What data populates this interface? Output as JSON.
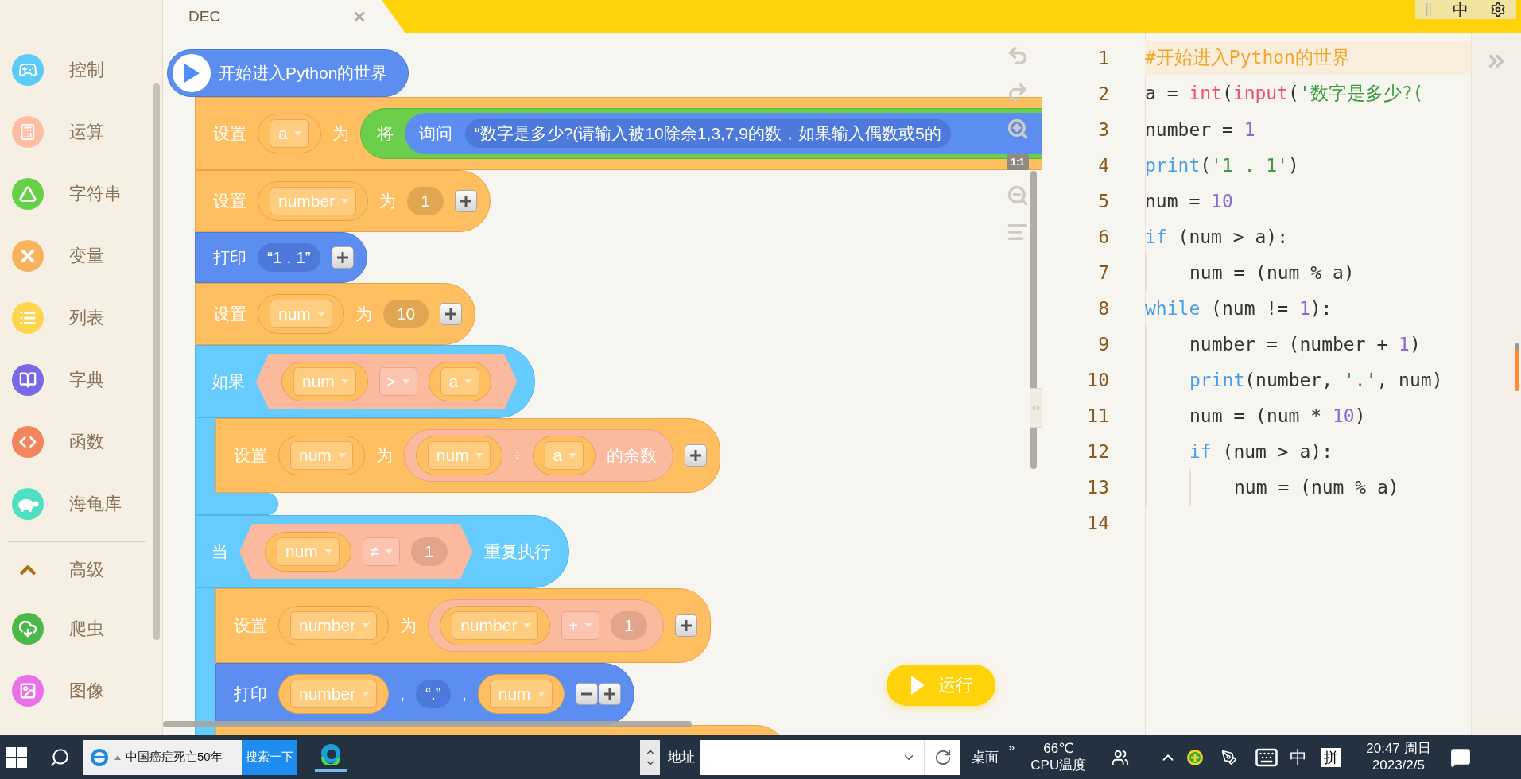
{
  "sidebar": {
    "categories": [
      {
        "label": "控制",
        "color": "#5ccbfa"
      },
      {
        "label": "运算",
        "color": "#ffbda3"
      },
      {
        "label": "字符串",
        "color": "#66d04a"
      },
      {
        "label": "变量",
        "color": "#f8b15c"
      },
      {
        "label": "列表",
        "color": "#ffd54f"
      },
      {
        "label": "字典",
        "color": "#7b68e6"
      },
      {
        "label": "函数",
        "color": "#f2855e"
      },
      {
        "label": "海龟库",
        "color": "#4ee0c2"
      }
    ],
    "advanced": {
      "label": "高级",
      "expanded": true
    },
    "extras": [
      {
        "label": "爬虫",
        "color": "#4cb84a"
      },
      {
        "label": "图像",
        "color": "#ea6fe9"
      }
    ]
  },
  "tab": {
    "title": "DEC"
  },
  "top_right": {
    "ime": "中"
  },
  "canvas_tools": {
    "zoom_reset": "1:1"
  },
  "blocks": [
    {
      "kind": "hat",
      "text": "开始进入Python的世界"
    },
    {
      "kind": "set",
      "parts": [
        {
          "kind": "label",
          "text": "设置"
        },
        {
          "kind": "var",
          "text": "a"
        },
        {
          "kind": "label",
          "text": "为"
        },
        {
          "kind": "convert",
          "label": "将",
          "ask": {
            "label": "询问",
            "value": "“数字是多少?(请输入被10除余1,3,7,9的数，如果输入偶数或5的"
          }
        }
      ]
    },
    {
      "kind": "set",
      "parts": [
        {
          "kind": "label",
          "text": "设置"
        },
        {
          "kind": "var",
          "text": "number"
        },
        {
          "kind": "label",
          "text": "为"
        },
        {
          "kind": "number",
          "text": "1"
        },
        {
          "kind": "plus"
        }
      ]
    },
    {
      "kind": "print",
      "parts": [
        {
          "kind": "label",
          "text": "打印"
        },
        {
          "kind": "string",
          "text": "“1 . 1”"
        },
        {
          "kind": "plus"
        }
      ]
    },
    {
      "kind": "set",
      "parts": [
        {
          "kind": "label",
          "text": "设置"
        },
        {
          "kind": "var",
          "text": "num"
        },
        {
          "kind": "label",
          "text": "为"
        },
        {
          "kind": "number",
          "text": "10"
        },
        {
          "kind": "plus"
        }
      ]
    },
    {
      "kind": "if",
      "parts": [
        {
          "kind": "label",
          "text": "如果"
        },
        {
          "kind": "cond",
          "parts": [
            {
              "kind": "var",
              "text": "num"
            },
            {
              "kind": "op",
              "text": ">"
            },
            {
              "kind": "var",
              "text": "a"
            }
          ]
        }
      ],
      "children": [
        {
          "kind": "set",
          "parts": [
            {
              "kind": "label",
              "text": "设置"
            },
            {
              "kind": "var",
              "text": "num"
            },
            {
              "kind": "label",
              "text": "为"
            },
            {
              "kind": "expr",
              "parts": [
                {
                  "kind": "var",
                  "text": "num"
                },
                {
                  "kind": "symbol",
                  "text": "÷"
                },
                {
                  "kind": "var",
                  "text": "a"
                },
                {
                  "kind": "label",
                  "text": "的余数"
                }
              ]
            },
            {
              "kind": "plus"
            }
          ]
        }
      ]
    },
    {
      "kind": "while",
      "parts": [
        {
          "kind": "label",
          "text": "当"
        },
        {
          "kind": "cond",
          "parts": [
            {
              "kind": "var",
              "text": "num"
            },
            {
              "kind": "op",
              "text": "≠"
            },
            {
              "kind": "number",
              "text": "1"
            }
          ]
        },
        {
          "kind": "label",
          "text": "重复执行"
        }
      ],
      "children": [
        {
          "kind": "set",
          "parts": [
            {
              "kind": "label",
              "text": "设置"
            },
            {
              "kind": "var",
              "text": "number"
            },
            {
              "kind": "label",
              "text": "为"
            },
            {
              "kind": "expr",
              "parts": [
                {
                  "kind": "var",
                  "text": "number"
                },
                {
                  "kind": "op",
                  "text": "+"
                },
                {
                  "kind": "number",
                  "text": "1"
                }
              ]
            },
            {
              "kind": "plus"
            }
          ]
        },
        {
          "kind": "print",
          "parts": [
            {
              "kind": "label",
              "text": "打印"
            },
            {
              "kind": "var",
              "text": "number"
            },
            {
              "kind": "label",
              "text": ","
            },
            {
              "kind": "string",
              "text": "“.”"
            },
            {
              "kind": "label",
              "text": ","
            },
            {
              "kind": "var",
              "text": "num"
            },
            {
              "kind": "minus"
            },
            {
              "kind": "plus"
            }
          ]
        },
        {
          "kind": "stub"
        }
      ]
    }
  ],
  "run_button": {
    "label": "运行"
  },
  "editor": {
    "lines": [
      {
        "number": "1",
        "highlighted": true,
        "tokens": [
          {
            "kind": "comment",
            "text": "#开始进入Python的世界"
          }
        ]
      },
      {
        "number": "2",
        "highlighted": false,
        "tokens": [
          {
            "kind": "plain",
            "text": "a = "
          },
          {
            "kind": "builtin",
            "text": "int"
          },
          {
            "kind": "plain",
            "text": "("
          },
          {
            "kind": "builtin",
            "text": "input"
          },
          {
            "kind": "plain",
            "text": "("
          },
          {
            "kind": "string",
            "text": "'数字是多少?("
          }
        ]
      },
      {
        "number": "3",
        "highlighted": false,
        "tokens": [
          {
            "kind": "plain",
            "text": "number = "
          },
          {
            "kind": "number",
            "text": "1"
          }
        ]
      },
      {
        "number": "4",
        "highlighted": false,
        "tokens": [
          {
            "kind": "keyword",
            "text": "print"
          },
          {
            "kind": "plain",
            "text": "("
          },
          {
            "kind": "string",
            "text": "'1 . 1'"
          },
          {
            "kind": "plain",
            "text": ")"
          }
        ]
      },
      {
        "number": "5",
        "highlighted": false,
        "tokens": [
          {
            "kind": "plain",
            "text": "num = "
          },
          {
            "kind": "number",
            "text": "10"
          }
        ]
      },
      {
        "number": "6",
        "highlighted": false,
        "tokens": [
          {
            "kind": "keyword",
            "text": "if"
          },
          {
            "kind": "plain",
            "text": " (num > a):"
          }
        ],
        "children": [
          {
            "number": "7",
            "highlighted": false,
            "tokens": [
              {
                "kind": "plain",
                "text": "num = (num % a)"
              }
            ]
          }
        ]
      },
      {
        "number": "8",
        "highlighted": false,
        "tokens": [
          {
            "kind": "keyword",
            "text": "while"
          },
          {
            "kind": "plain",
            "text": " (num != "
          },
          {
            "kind": "number",
            "text": "1"
          },
          {
            "kind": "plain",
            "text": "):"
          }
        ],
        "children": [
          {
            "number": "9",
            "highlighted": false,
            "tokens": [
              {
                "kind": "plain",
                "text": "number = (number + "
              },
              {
                "kind": "number",
                "text": "1"
              },
              {
                "kind": "plain",
                "text": ")"
              }
            ]
          },
          {
            "number": "10",
            "highlighted": false,
            "tokens": [
              {
                "kind": "keyword",
                "text": "print"
              },
              {
                "kind": "plain",
                "text": "(number, "
              },
              {
                "kind": "string",
                "text": "'.'"
              },
              {
                "kind": "plain",
                "text": ", num)"
              }
            ]
          },
          {
            "number": "11",
            "highlighted": false,
            "tokens": [
              {
                "kind": "plain",
                "text": "num = (num * "
              },
              {
                "kind": "number",
                "text": "10"
              },
              {
                "kind": "plain",
                "text": ")"
              }
            ]
          },
          {
            "number": "12",
            "highlighted": false,
            "tokens": [
              {
                "kind": "keyword",
                "text": "if"
              },
              {
                "kind": "plain",
                "text": " (num > a):"
              }
            ],
            "children": [
              {
                "number": "13",
                "highlighted": false,
                "tokens": [
                  {
                    "kind": "plain",
                    "text": "num = (num % a)"
                  }
                ]
              }
            ]
          }
        ]
      },
      {
        "number": "14",
        "highlighted": false
      }
    ]
  },
  "taskbar": {
    "search": {
      "value": "中国癌症死亡50年",
      "button": "搜索一下"
    },
    "address": {
      "label": "地址"
    },
    "desktop": "桌面",
    "more": "»",
    "cpu": {
      "temp": "66℃",
      "label": "CPU温度"
    },
    "ime": "中",
    "ime_mode": "拼",
    "time": "20:47 周日",
    "date": "2023/2/5"
  }
}
